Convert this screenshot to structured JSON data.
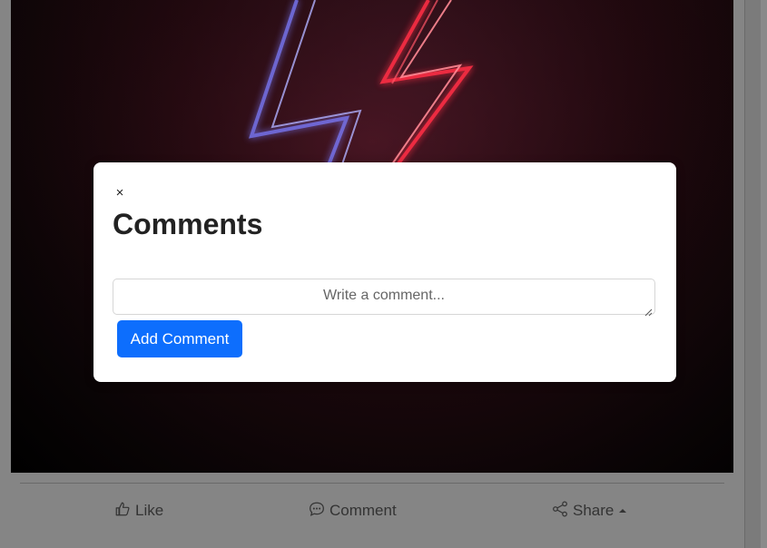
{
  "post": {
    "actions": [
      {
        "label": "Like",
        "icon": "thumbs-up-icon"
      },
      {
        "label": "Comment",
        "icon": "chat-bubble-icon"
      },
      {
        "label": "Share",
        "icon": "share-icon"
      }
    ]
  },
  "modal": {
    "close_label": "×",
    "title": "Comments",
    "input_placeholder": "Write a comment...",
    "input_value": "",
    "submit_label": "Add Comment"
  },
  "colors": {
    "primary": "#0d6efd",
    "backdrop": "#7b7b7b",
    "neon_red": "#ff3344",
    "neon_blue": "#6a6aff"
  }
}
